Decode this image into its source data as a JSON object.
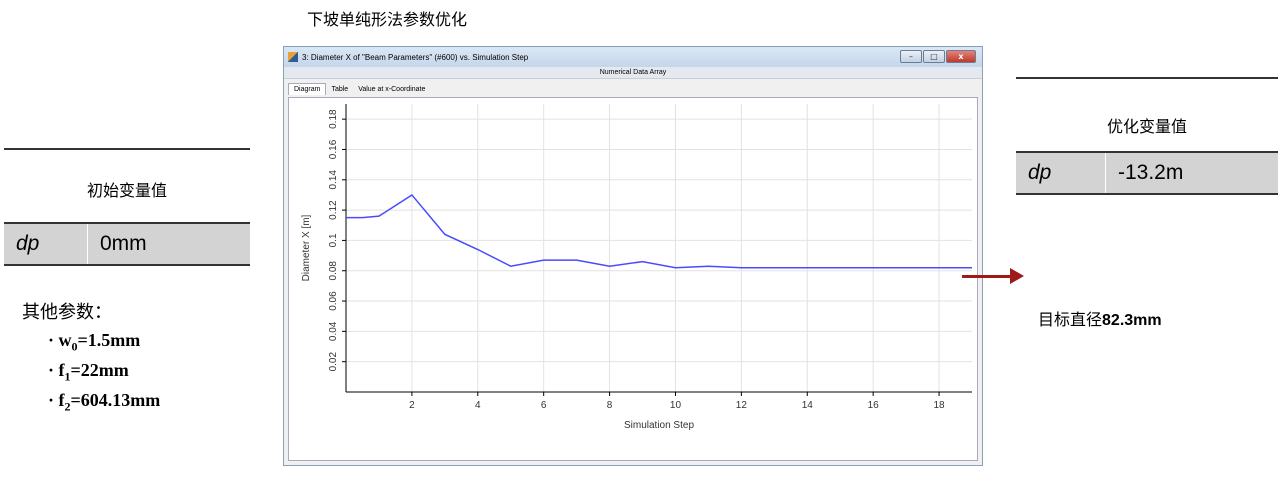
{
  "page_title": "下坡单纯形法参数优化",
  "initial": {
    "heading": "初始变量值",
    "var_name": "dp",
    "var_value": "0mm"
  },
  "other_params": {
    "label": "其他参数：",
    "items": [
      {
        "bullet": "· ",
        "symbol": "w",
        "sub": "0",
        "rest": "=1.5mm"
      },
      {
        "bullet": "· ",
        "symbol": "f",
        "sub": "1",
        "rest": "=22mm"
      },
      {
        "bullet": "· ",
        "symbol": "f",
        "sub": "2",
        "rest": "=604.13mm"
      }
    ]
  },
  "window": {
    "title": "3: Diameter X of \"Beam Parameters\" (#600) vs. Simulation Step",
    "subtitle": "Numerical Data Array",
    "tabs": [
      "Diagram",
      "Table",
      "Value at x-Coordinate"
    ],
    "active_tab": 0,
    "buttons": {
      "minimize": "–",
      "maximize": "□",
      "close": "x"
    }
  },
  "chart_data": {
    "type": "line",
    "xlabel": "Simulation Step",
    "ylabel": "Diameter X [m]",
    "xlim": [
      0,
      19
    ],
    "ylim": [
      0,
      0.19
    ],
    "xticks": [
      2,
      4,
      6,
      8,
      10,
      12,
      14,
      16,
      18
    ],
    "yticks": [
      0.02,
      0.04,
      0.06,
      0.08,
      0.1,
      0.12,
      0.14,
      0.16,
      0.18
    ],
    "grid": true,
    "line_color": "#4a4aff",
    "x": [
      0,
      0.5,
      1,
      2,
      3,
      4,
      5,
      6,
      7,
      8,
      9,
      10,
      11,
      12,
      13,
      14,
      15,
      16,
      17,
      18,
      19
    ],
    "y": [
      0.115,
      0.115,
      0.116,
      0.13,
      0.104,
      0.094,
      0.083,
      0.087,
      0.087,
      0.083,
      0.086,
      0.082,
      0.083,
      0.082,
      0.082,
      0.082,
      0.082,
      0.082,
      0.082,
      0.082,
      0.082
    ]
  },
  "optimized": {
    "heading": "优化变量值",
    "var_name": "dp",
    "var_value": "-13.2m"
  },
  "target": {
    "label": "目标直径",
    "value": "82.3mm"
  },
  "colors": {
    "arrow": "#a01919",
    "table_bg": "#d3d3d3"
  }
}
